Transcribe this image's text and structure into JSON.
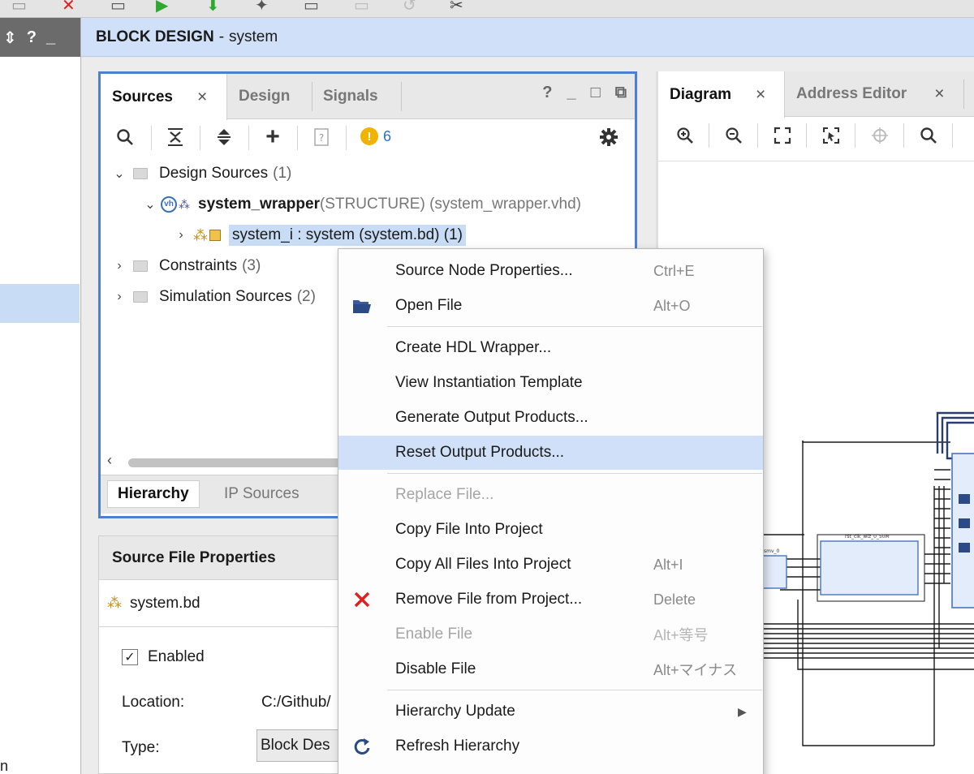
{
  "block_design_header": {
    "title": "BLOCK DESIGN",
    "separator": "-",
    "name": "system"
  },
  "sources_panel": {
    "tabs": [
      {
        "label": "Sources",
        "close": "×"
      },
      {
        "label": "Design"
      },
      {
        "label": "Signals"
      }
    ],
    "window_buttons": [
      "?",
      "_",
      "□",
      "⧉"
    ],
    "warning_count": "6",
    "tree": {
      "design_sources": {
        "label": "Design Sources",
        "count": "(1)"
      },
      "system_wrapper": {
        "name": "system_wrapper",
        "detail": "(STRUCTURE) (system_wrapper.vhd)"
      },
      "system_i": {
        "label": "system_i : system (system.bd) (1)"
      },
      "constraints": {
        "label": "Constraints",
        "count": "(3)"
      },
      "simulation_sources": {
        "label": "Simulation Sources",
        "count": "(2)"
      }
    },
    "bottom_tabs": [
      "Hierarchy",
      "IP Sources"
    ]
  },
  "source_file_properties": {
    "title": "Source File Properties",
    "file": "system.bd",
    "enabled_label": "Enabled",
    "location_label": "Location:",
    "location_value": "C:/Github/",
    "type_label": "Type:",
    "type_value": "Block Des"
  },
  "diagram_panel": {
    "tabs": [
      {
        "label": "Diagram",
        "close": "×"
      },
      {
        "label": "Address Editor",
        "close": "×"
      }
    ],
    "block_labels": {
      "small": "smv_0",
      "main": "rst_clk_wiz_0_50M"
    }
  },
  "context_menu": {
    "items": [
      {
        "label": "Source Node Properties...",
        "shortcut": "Ctrl+E"
      },
      {
        "label": "Open File",
        "shortcut": "Alt+O",
        "icon": "folder-open-icon"
      },
      {
        "label": "Create HDL Wrapper..."
      },
      {
        "label": "View Instantiation Template"
      },
      {
        "label": "Generate Output Products..."
      },
      {
        "label": "Reset Output Products..."
      },
      {
        "label": "Replace File..."
      },
      {
        "label": "Copy File Into Project"
      },
      {
        "label": "Copy All Files Into Project",
        "shortcut": "Alt+I"
      },
      {
        "label": "Remove File from Project...",
        "shortcut": "Delete",
        "icon": "red-x-icon"
      },
      {
        "label": "Enable File",
        "shortcut": "Alt+等号"
      },
      {
        "label": "Disable File",
        "shortcut": "Alt+マイナス"
      },
      {
        "label": "Hierarchy Update"
      },
      {
        "label": "Refresh Hierarchy",
        "icon": "refresh-icon"
      }
    ]
  },
  "left_strip": {
    "header_icons": [
      "⇕",
      "?",
      "_"
    ],
    "fragment": "n"
  },
  "colors": {
    "accent_blue": "#4f7fcf",
    "selection": "#c8dcf5",
    "header_bg": "#cfe0f8",
    "remove_red": "#e02020",
    "warning": "#f0b400"
  }
}
